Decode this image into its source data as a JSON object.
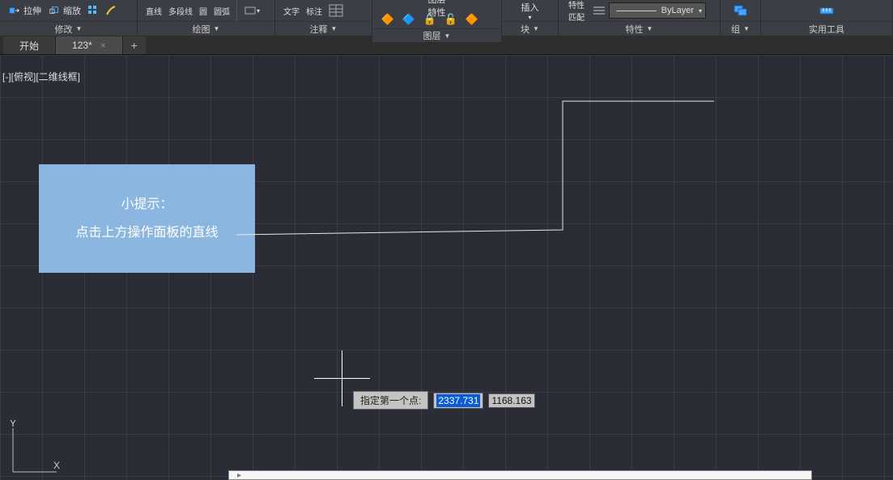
{
  "ribbon": {
    "top_small_labels": [
      "直线",
      "多段线",
      "圆",
      "圆弧",
      "",
      "文字",
      "标注",
      "",
      "图层",
      "",
      "",
      "",
      "插入",
      "",
      "特性",
      "",
      "",
      "测量"
    ],
    "modify": {
      "stretch": "拉伸",
      "scale": "缩放",
      "label": "修改"
    },
    "draw": {
      "label": "绘图"
    },
    "annotate": {
      "text": "文字",
      "dim": "标注",
      "table_icon": "table",
      "label": "注释"
    },
    "layer": {
      "top": "图层",
      "props": "特性",
      "label": "图层"
    },
    "block": {
      "insert": "插入",
      "label": "块"
    },
    "props": {
      "match": "特性匹配",
      "bylayer_text": "ByLayer",
      "label": "特性"
    },
    "group": {
      "label": "组"
    },
    "util": {
      "label": "实用工具"
    }
  },
  "tabs": {
    "start": "开始",
    "doc": "123*",
    "add": "+"
  },
  "canvas": {
    "view_label": "-][俯视][二维线框]",
    "tip_title": "小提示：",
    "tip_body": "点击上方操作面板的直线",
    "prompt_label": "指定第一个点:",
    "coord_x": "2337.731",
    "coord_y": "1168.163",
    "ucs_y": "Y",
    "ucs_x": "X"
  },
  "cmdline": ""
}
